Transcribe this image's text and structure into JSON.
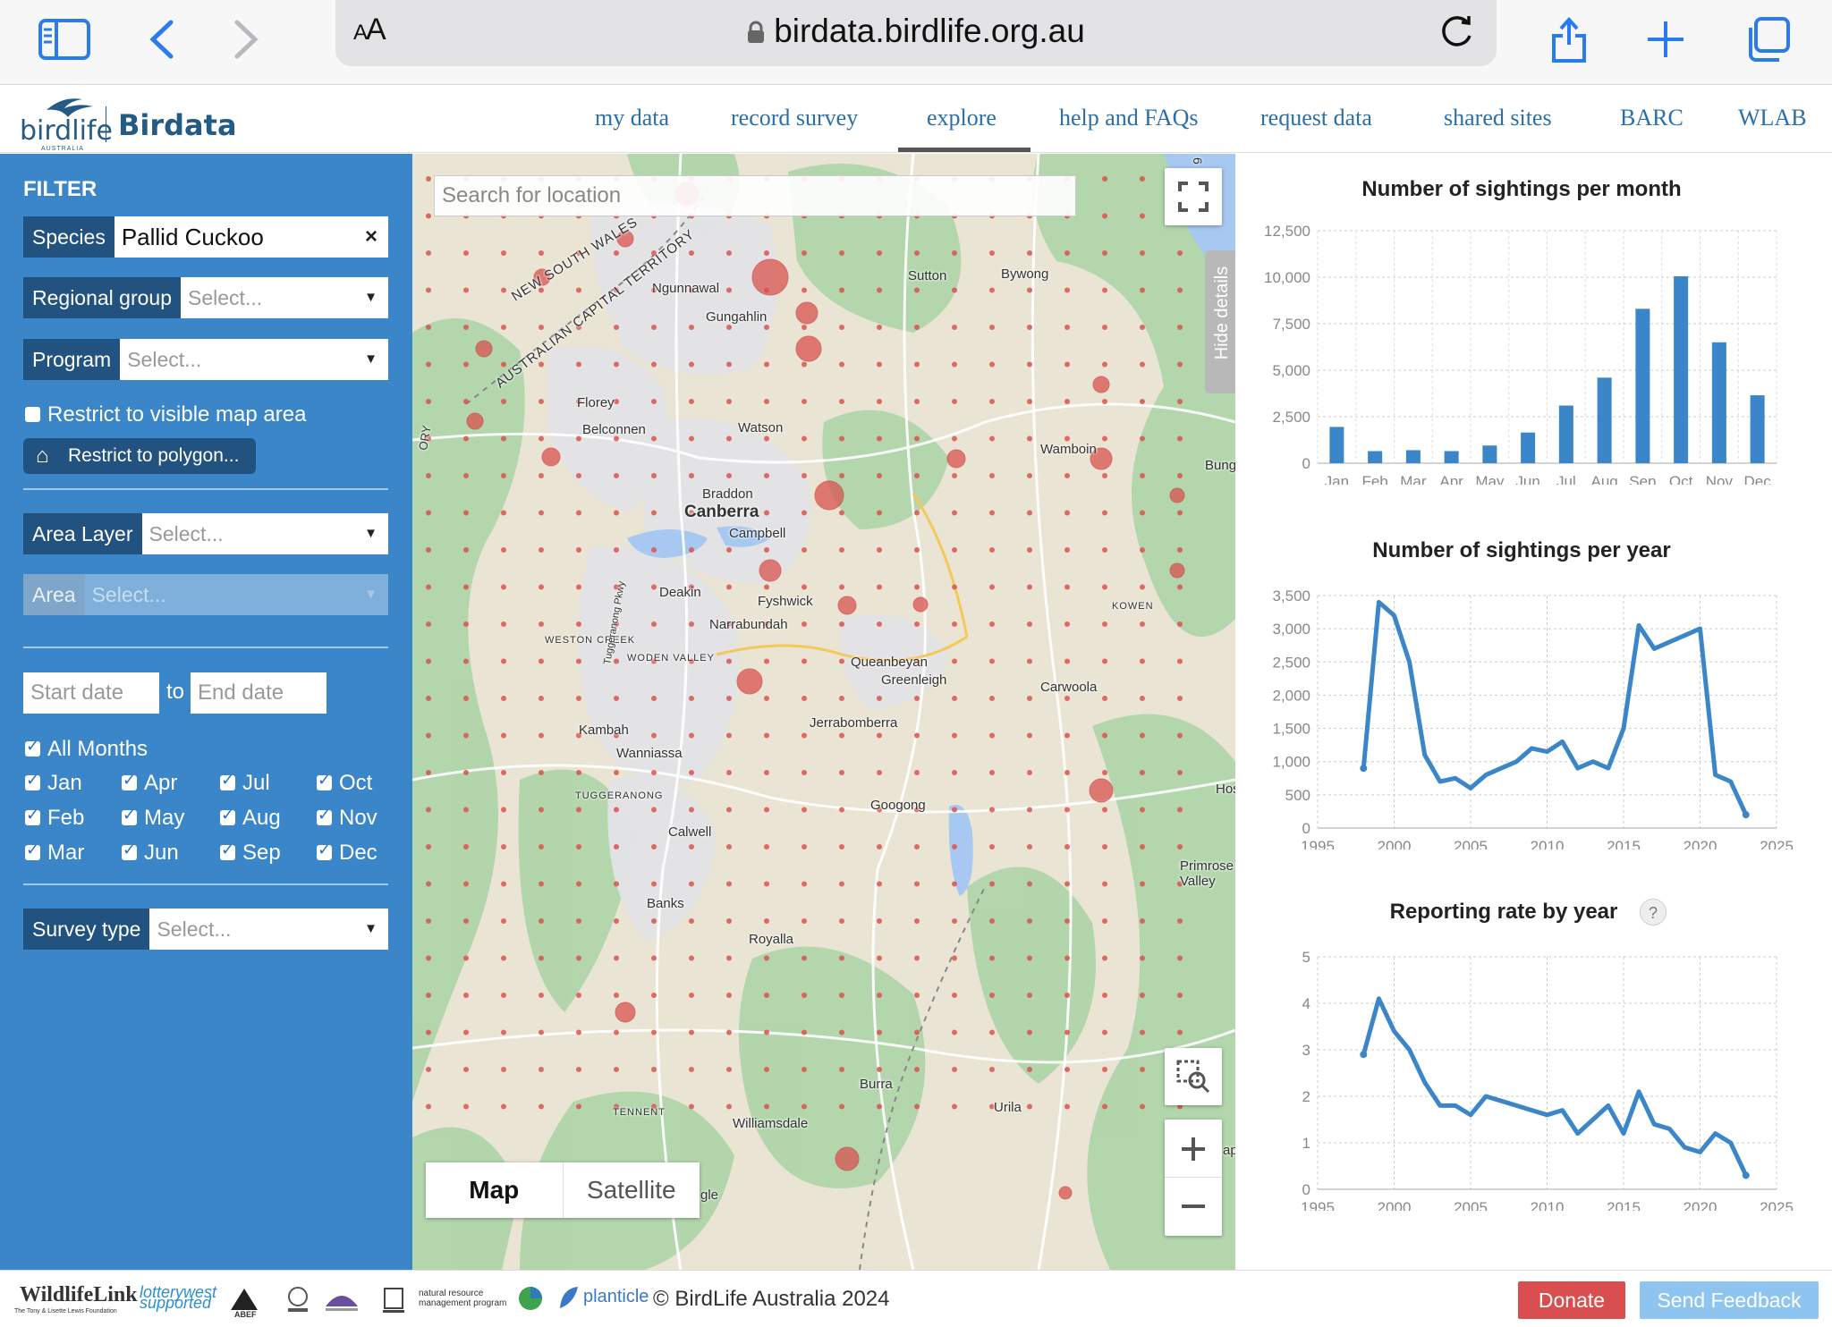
{
  "browser": {
    "url": "birdata.birdlife.org.au",
    "aa_small": "A",
    "aa_big": "A"
  },
  "site": {
    "logo_text": "birdlife",
    "logo_sub": "AUSTRALIA",
    "brand": "Birdata",
    "nav": [
      {
        "label": "my data"
      },
      {
        "label": "record survey"
      },
      {
        "label": "explore"
      },
      {
        "label": "help and FAQs"
      },
      {
        "label": "request data"
      },
      {
        "label": "shared sites"
      },
      {
        "label": "BARC"
      },
      {
        "label": "WLAB"
      }
    ],
    "active_nav": "explore"
  },
  "filter": {
    "title": "FILTER",
    "species_label": "Species",
    "species_value": "Pallid Cuckoo",
    "regional_label": "Regional group",
    "program_label": "Program",
    "select_placeholder": "Select...",
    "restrict_label": "Restrict to visible map area",
    "polygon_label": "Restrict to polygon...",
    "area_layer_label": "Area Layer",
    "area_label": "Area",
    "start_placeholder": "Start date",
    "to_label": "to",
    "end_placeholder": "End date",
    "all_months": "All Months",
    "months": [
      "Jan",
      "Apr",
      "Jul",
      "Oct",
      "Feb",
      "May",
      "Aug",
      "Nov",
      "Mar",
      "Jun",
      "Sep",
      "Dec"
    ],
    "survey_type_label": "Survey type"
  },
  "map": {
    "search_placeholder": "Search for location",
    "hide_details": "Hide details",
    "map_label": "Map",
    "satellite_label": "Satellite",
    "places": [
      "Canberra",
      "Belconnen",
      "Gungahlin",
      "Ngunnawal",
      "Florey",
      "Watson",
      "Braddon",
      "Campbell",
      "Deakin",
      "Fyshwick",
      "Narrabundah",
      "WESTON CREEK",
      "WODEN VALLEY",
      "Queanbeyan",
      "Greenleigh",
      "Jerrabomberra",
      "Kambah",
      "Wanniassa",
      "TUGGERANONG",
      "Calwell",
      "Googong",
      "Banks",
      "Royalla",
      "Burra",
      "Williamsdale",
      "TENNENT",
      "Urila",
      "Sutton",
      "Bywong",
      "Wamboin",
      "Bung",
      "KOWEN",
      "Carwoola",
      "Primrose Valley",
      "Hos",
      "gle",
      "ap",
      "NEW SOUTH WALES",
      "AUSTRALIAN CAPITAL TERRITORY",
      "Tuggeranong Pkwy",
      "6",
      "ORY"
    ]
  },
  "chart_data": [
    {
      "type": "bar",
      "title": "Number of sightings per month",
      "categories": [
        "Jan",
        "Feb",
        "Mar",
        "Apr",
        "May",
        "Jun",
        "Jul",
        "Aug",
        "Sep",
        "Oct",
        "Nov",
        "Dec"
      ],
      "values": [
        1950,
        650,
        700,
        650,
        950,
        1650,
        3100,
        4600,
        8300,
        10050,
        6500,
        3650
      ],
      "ylim": [
        0,
        12500
      ],
      "yticks": [
        "0",
        "2,500",
        "5,000",
        "7,500",
        "10,000",
        "12,500"
      ],
      "grid": true,
      "color": "#3a86c8"
    },
    {
      "type": "line",
      "title": "Number of sightings per year",
      "x": [
        1998,
        1999,
        2000,
        2001,
        2002,
        2003,
        2004,
        2005,
        2006,
        2007,
        2008,
        2009,
        2010,
        2011,
        2012,
        2013,
        2014,
        2015,
        2016,
        2017,
        2018,
        2019,
        2020,
        2021,
        2022,
        2023
      ],
      "y": [
        900,
        3400,
        3200,
        2500,
        1100,
        700,
        750,
        600,
        800,
        900,
        1000,
        1200,
        1150,
        1300,
        900,
        1000,
        900,
        1500,
        3050,
        2700,
        2800,
        2900,
        3000,
        800,
        700,
        200
      ],
      "ylim": [
        0,
        3500
      ],
      "xlim": [
        1995,
        2025
      ],
      "yticks": [
        "0",
        "500",
        "1,000",
        "1,500",
        "2,000",
        "2,500",
        "3,000",
        "3,500"
      ],
      "xticks": [
        "1995",
        "2000",
        "2005",
        "2010",
        "2015",
        "2020",
        "2025"
      ],
      "grid": true,
      "color": "#3a86c8"
    },
    {
      "type": "line",
      "title": "Reporting rate by year",
      "help": "?",
      "x": [
        1998,
        1999,
        2000,
        2001,
        2002,
        2003,
        2004,
        2005,
        2006,
        2007,
        2008,
        2009,
        2010,
        2011,
        2012,
        2013,
        2014,
        2015,
        2016,
        2017,
        2018,
        2019,
        2020,
        2021,
        2022,
        2023
      ],
      "y": [
        2.9,
        4.1,
        3.4,
        3.0,
        2.3,
        1.8,
        1.8,
        1.6,
        2.0,
        1.9,
        1.8,
        1.7,
        1.6,
        1.7,
        1.2,
        1.5,
        1.8,
        1.2,
        2.1,
        1.4,
        1.3,
        0.9,
        0.8,
        1.2,
        1.0,
        0.3
      ],
      "ylim": [
        0,
        5
      ],
      "xlim": [
        1995,
        2025
      ],
      "yticks": [
        "0",
        "1",
        "2",
        "3",
        "4",
        "5"
      ],
      "xticks": [
        "1995",
        "2000",
        "2005",
        "2010",
        "2015",
        "2020",
        "2025"
      ],
      "grid": true,
      "color": "#3a86c8"
    }
  ],
  "footer": {
    "sponsors": [
      "WildlifeLink",
      "The Tony & Lisette Lewis Foundation",
      "lotterywest supported",
      "ABEF",
      "natural resource management program",
      "planticle"
    ],
    "copyright": "© BirdLife Australia 2024",
    "donate": "Donate",
    "feedback": "Send Feedback"
  },
  "colors": {
    "sidebar": "#3a86c8",
    "label_bg": "#22527f",
    "nav_link": "#2c6fa6",
    "donate": "#d94f4f",
    "feedback": "#8ec5f0",
    "map_dot": "#d9534f"
  }
}
